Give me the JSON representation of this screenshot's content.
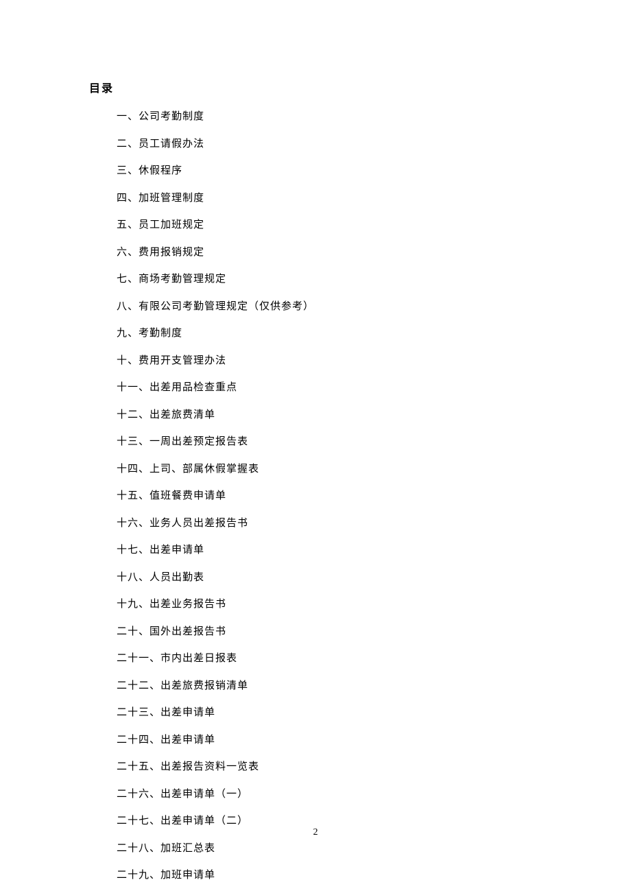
{
  "title": "目录",
  "toc": {
    "items": [
      "一、公司考勤制度",
      "二、员工请假办法",
      "三、休假程序",
      "四、加班管理制度",
      "五、员工加班规定",
      "六、费用报销规定",
      "七、商场考勤管理规定",
      "八、有限公司考勤管理规定（仅供参考）",
      "九、考勤制度",
      "十、费用开支管理办法",
      "十一、出差用品检查重点",
      "十二、出差旅费清单",
      "十三、一周出差预定报告表",
      "十四、上司、部属休假掌握表",
      "十五、值班餐费申请单",
      "十六、业务人员出差报告书",
      "十七、出差申请单",
      "十八、人员出勤表",
      "十九、出差业务报告书",
      "二十、国外出差报告书",
      "二十一、市内出差日报表",
      "二十二、出差旅费报销清单",
      "二十三、出差申请单",
      "二十四、出差申请单",
      "二十五、出差报告资料一览表",
      "二十六、出差申请单（一）",
      "二十七、出差申请单（二）",
      "二十八、加班汇总表",
      "二十九、加班申请单"
    ]
  },
  "pageNumber": "2"
}
